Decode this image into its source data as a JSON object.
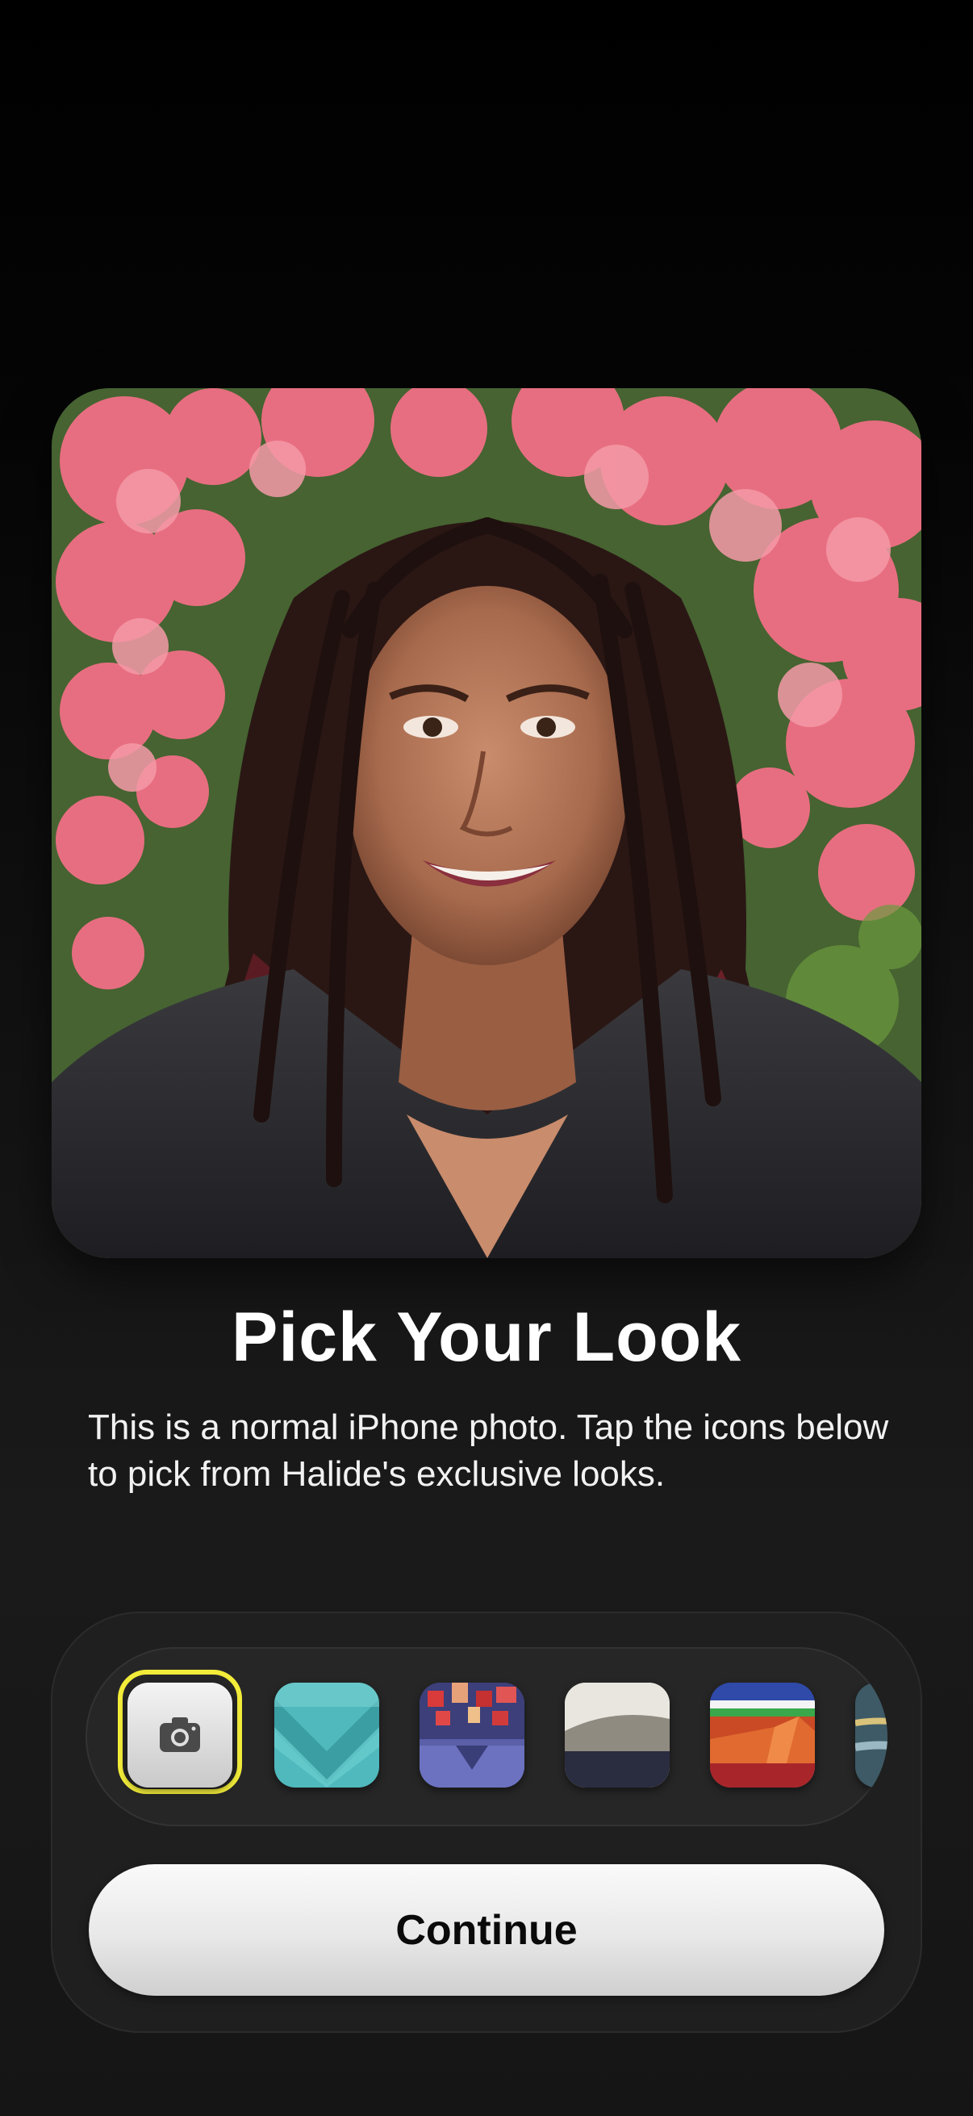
{
  "onboarding": {
    "title": "Pick Your Look",
    "description": "This is a normal iPhone photo. Tap the icons below to pick from Halide's exclusive looks.",
    "continue_label": "Continue"
  },
  "looks": [
    {
      "icon": "camera-icon",
      "selected": true
    },
    {
      "icon": "teal-chevron-look-icon",
      "selected": false
    },
    {
      "icon": "red-pixel-look-icon",
      "selected": false
    },
    {
      "icon": "silver-landscape-look-icon",
      "selected": false
    },
    {
      "icon": "orange-pyramid-look-icon",
      "selected": false
    },
    {
      "icon": "partial-look-icon",
      "selected": false
    }
  ],
  "colors": {
    "selection_ring": "#f2ec3a",
    "background": "#000000",
    "button": "#e8e8e8"
  }
}
